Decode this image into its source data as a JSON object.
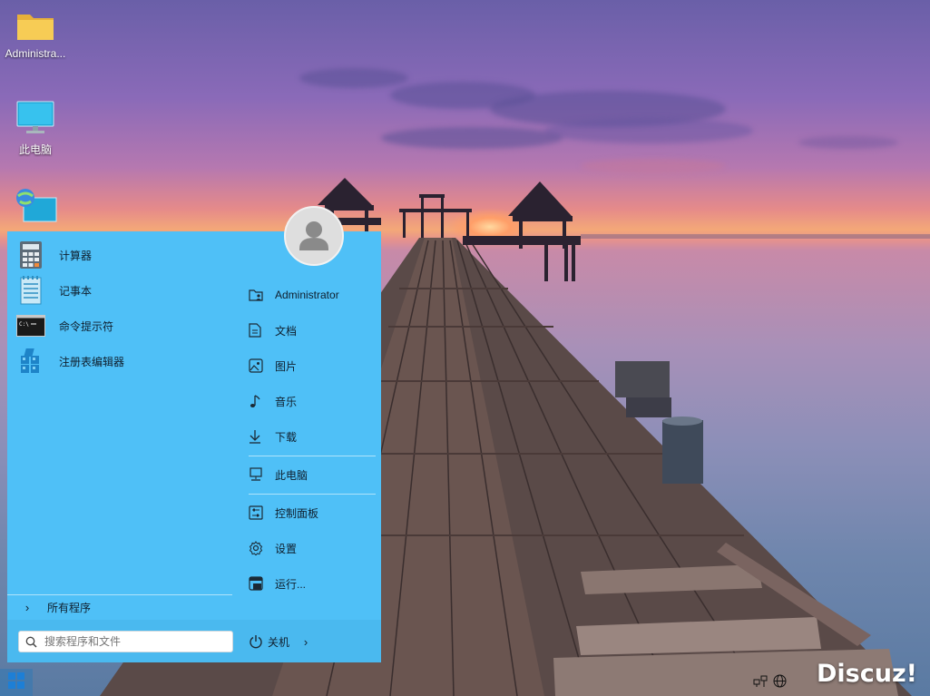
{
  "desktop": {
    "icons": [
      {
        "label": "Administra...",
        "icon": "folder-icon"
      },
      {
        "label": "此电脑",
        "icon": "computer-icon"
      },
      {
        "label": "",
        "icon": "network-icon"
      }
    ]
  },
  "start_menu": {
    "programs": [
      {
        "label": "计算器",
        "icon": "calculator-icon"
      },
      {
        "label": "记事本",
        "icon": "notepad-icon"
      },
      {
        "label": "命令提示符",
        "icon": "command-prompt-icon"
      },
      {
        "label": "注册表编辑器",
        "icon": "registry-editor-icon"
      }
    ],
    "all_programs_label": "所有程序",
    "places": [
      {
        "label": "Administrator",
        "icon": "user-folder-icon"
      },
      {
        "label": "文档",
        "icon": "document-icon"
      },
      {
        "label": "图片",
        "icon": "picture-icon"
      },
      {
        "label": "音乐",
        "icon": "music-icon"
      },
      {
        "label": "下载",
        "icon": "download-icon"
      },
      {
        "label": "此电脑",
        "icon": "computer-icon"
      },
      {
        "label": "控制面板",
        "icon": "control-panel-icon"
      },
      {
        "label": "设置",
        "icon": "settings-icon"
      },
      {
        "label": "运行...",
        "icon": "run-icon"
      }
    ],
    "search_placeholder": "搜索程序和文件",
    "power_label": "关机",
    "accent_color": "#4fc0f7"
  },
  "taskbar": {
    "start_icon": "windows-logo-icon",
    "tray_icons": [
      "network-icon",
      "globe-icon"
    ]
  },
  "watermark": "Discuz!"
}
